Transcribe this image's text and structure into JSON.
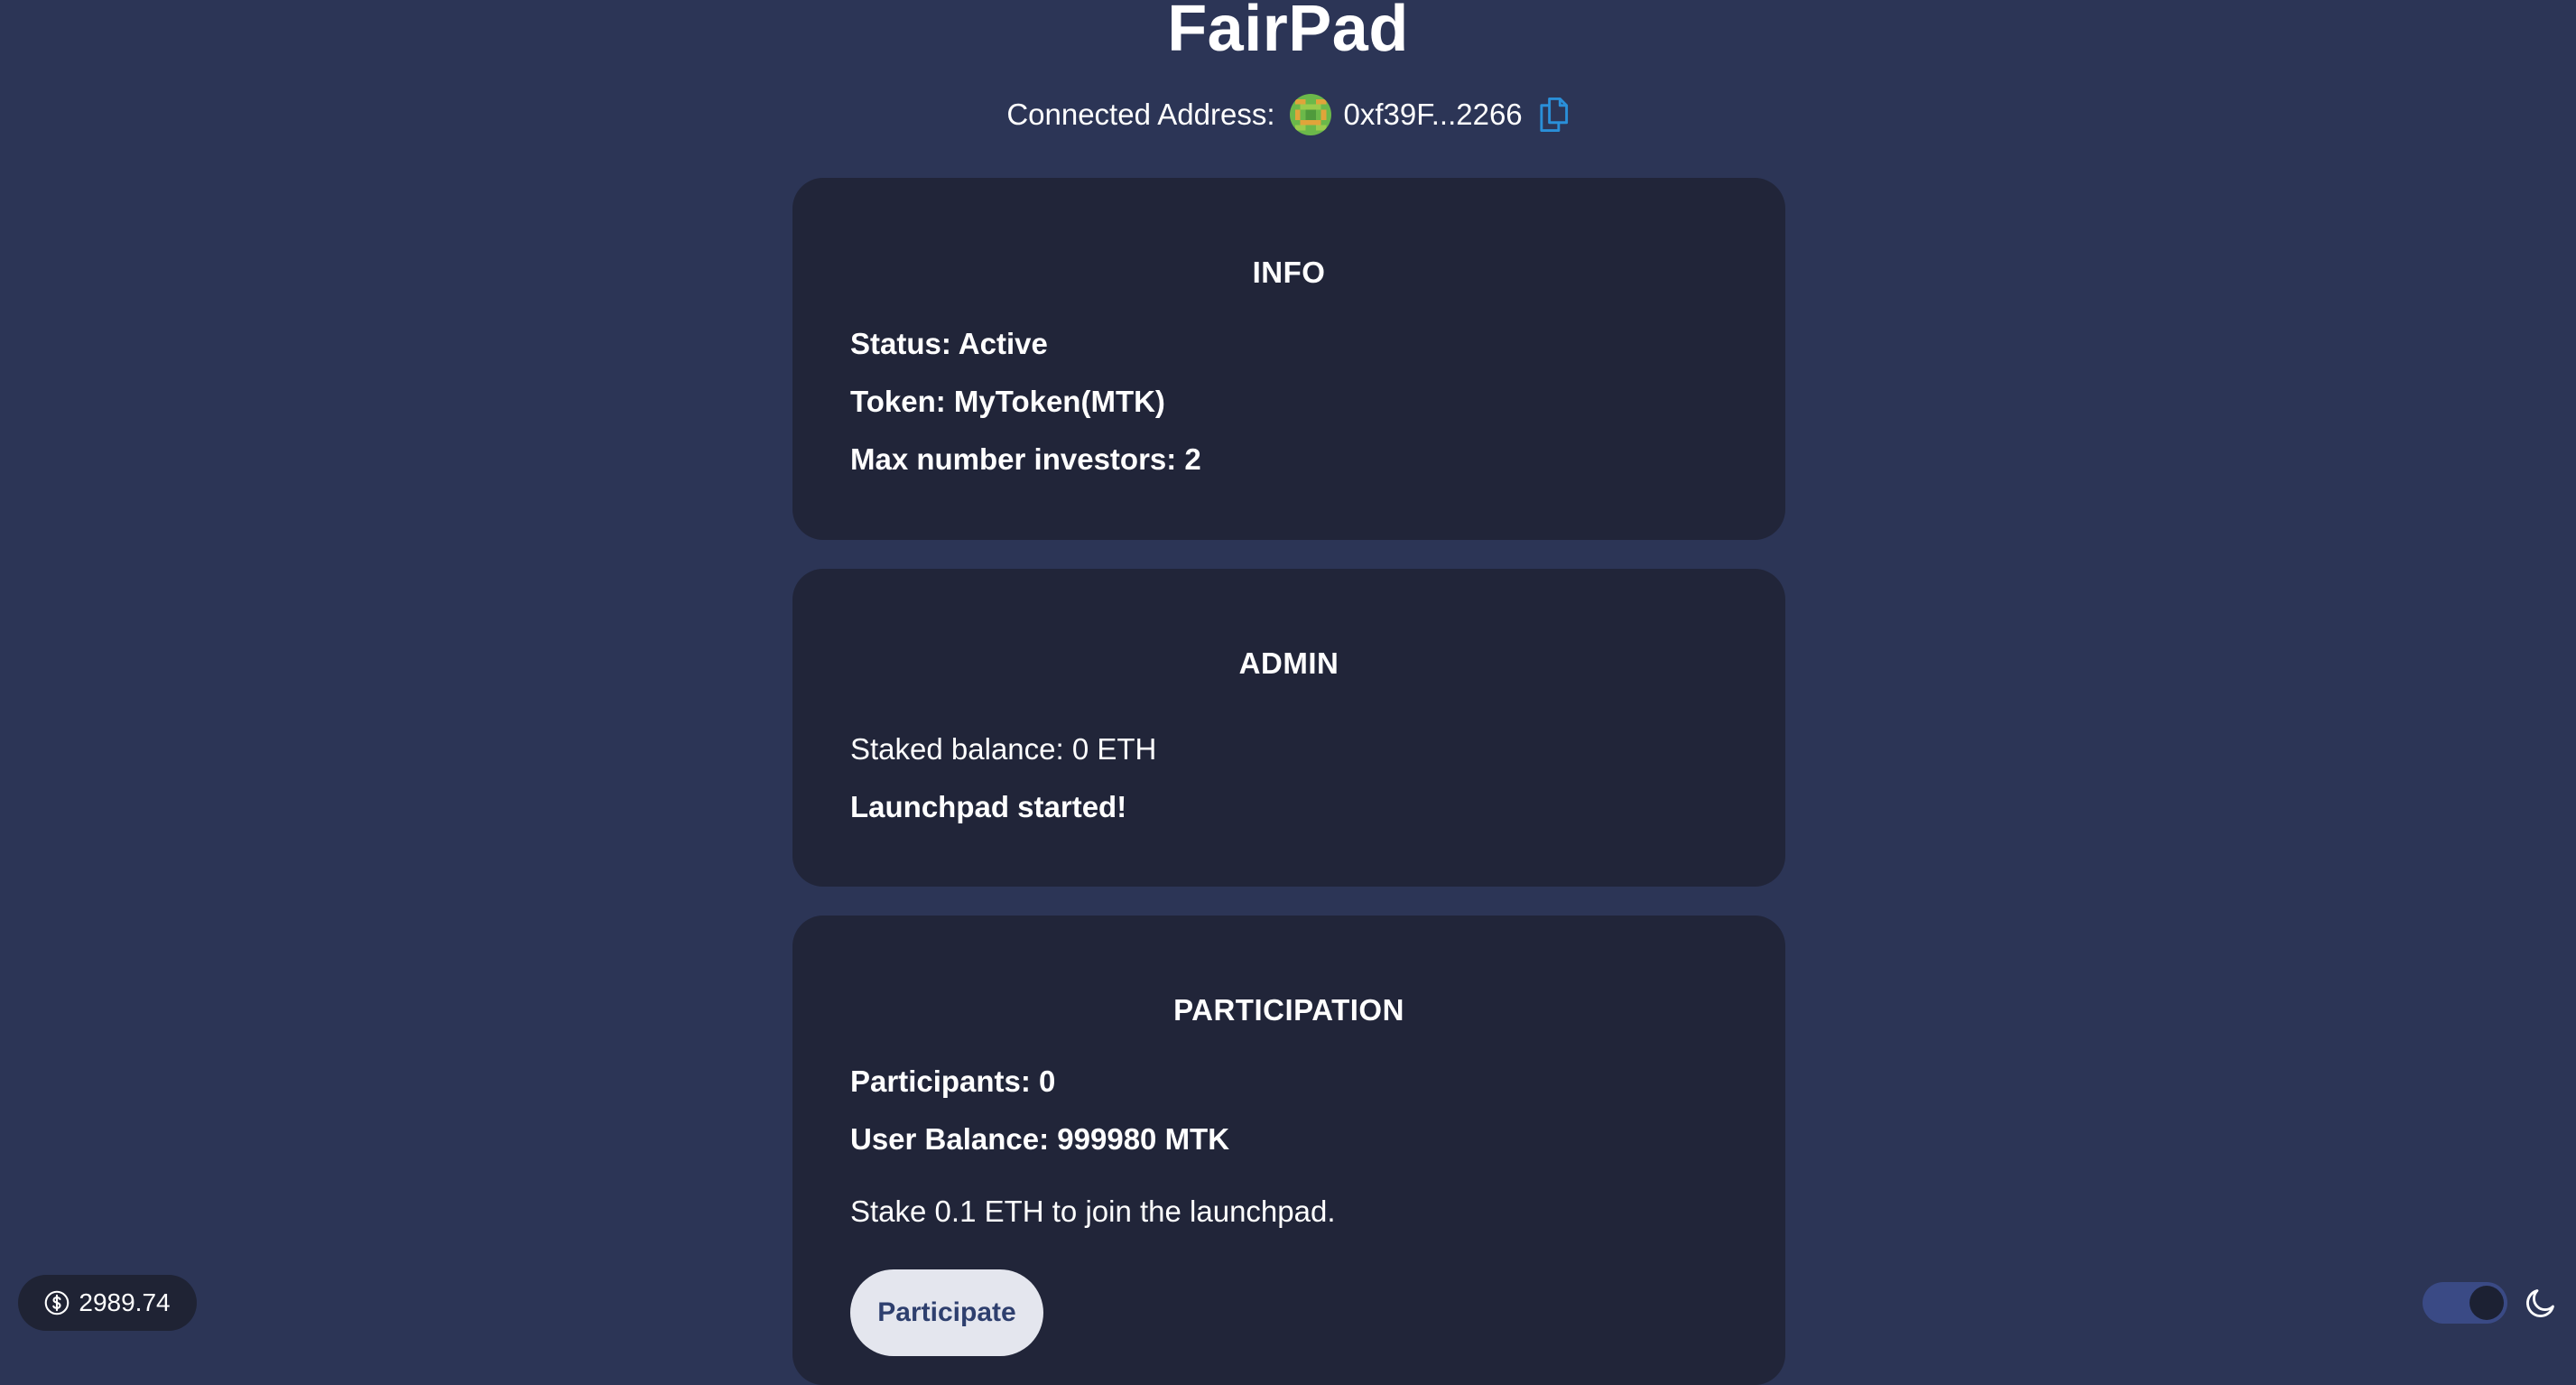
{
  "header": {
    "title": "FairPad",
    "connected_label": "Connected Address:",
    "address": "0xf39F...2266"
  },
  "info": {
    "title": "INFO",
    "status": "Status: Active",
    "token": "Token: MyToken(MTK)",
    "max_investors": "Max number investors: 2"
  },
  "admin": {
    "title": "ADMIN",
    "staked_balance": "Staked balance: 0 ETH",
    "launch_status": "Launchpad started!"
  },
  "participation": {
    "title": "PARTICIPATION",
    "participants": "Participants: 0",
    "user_balance": "User Balance: 999980 MTK",
    "stake_prompt": "Stake 0.1 ETH to join the launchpad.",
    "participate_label": "Participate"
  },
  "footer": {
    "eth_price": "2989.74",
    "price_icon": "dollar-circle-icon",
    "theme_icon": "moon-icon",
    "dark_mode_on": true
  },
  "colors": {
    "background": "#2c3556",
    "card": "#212539",
    "button_bg": "#e4e6ee",
    "button_text": "#2e3f6e",
    "accent": "#2a8fd8",
    "toggle_track": "#3a4a85"
  }
}
